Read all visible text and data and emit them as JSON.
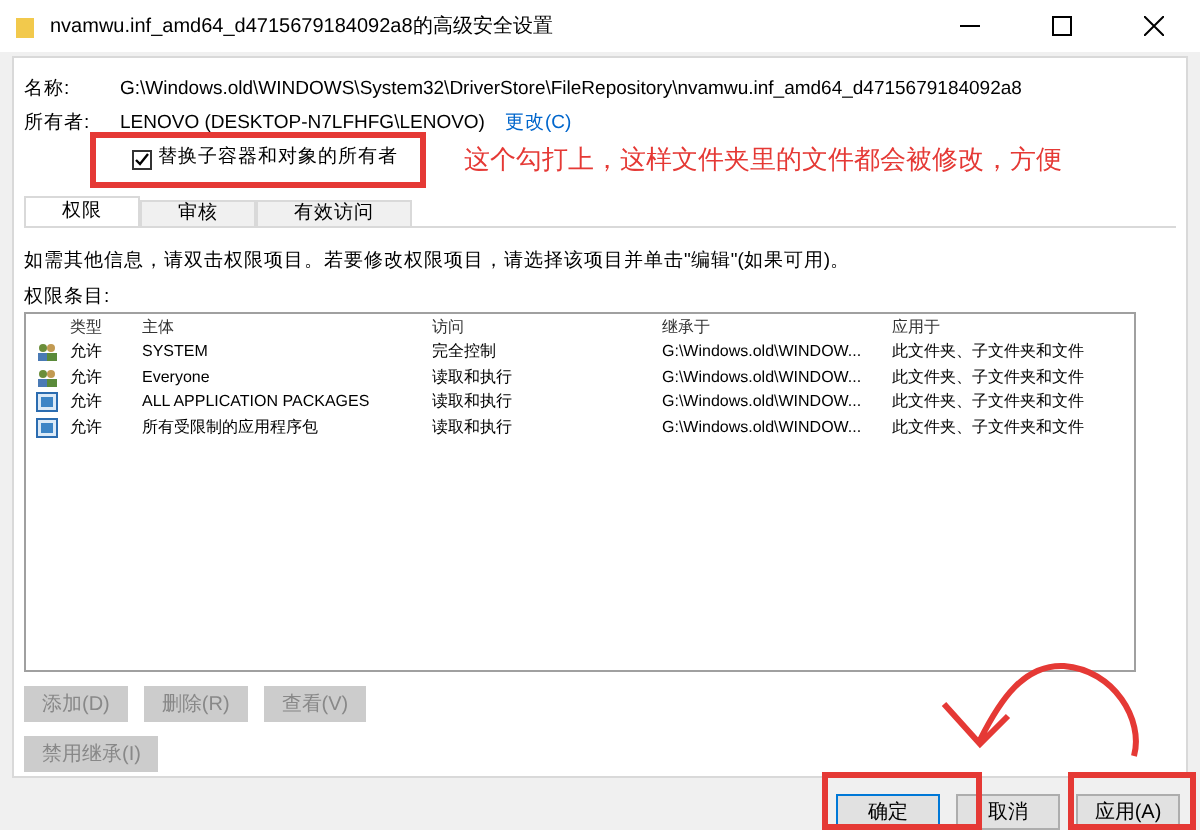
{
  "window": {
    "title": "nvamwu.inf_amd64_d4715679184092a8的高级安全设置"
  },
  "name_label": "名称:",
  "name_value": "G:\\Windows.old\\WINDOWS\\System32\\DriverStore\\FileRepository\\nvamwu.inf_amd64_d4715679184092a8",
  "owner_label": "所有者:",
  "owner_value": "LENOVO (DESKTOP-N7LFHFG\\LENOVO)",
  "owner_change": "更改(C)",
  "replace_owner": {
    "label": "替换子容器和对象的所有者",
    "checked": true
  },
  "annotation": "这个勾打上，这样文件夹里的文件都会被修改，方便",
  "tabs": [
    {
      "label": "权限",
      "selected": true
    },
    {
      "label": "审核",
      "selected": false
    },
    {
      "label": "有效访问",
      "selected": false
    }
  ],
  "info": "如需其他信息，请双击权限项目。若要修改权限项目，请选择该项目并单击\"编辑\"(如果可用)。",
  "entries_label": "权限条目:",
  "table": {
    "columns": [
      "类型",
      "主体",
      "访问",
      "继承于",
      "应用于"
    ],
    "rows": [
      {
        "kind": "user",
        "cells": [
          "允许",
          "SYSTEM",
          "完全控制",
          "G:\\Windows.old\\WINDOW...",
          "此文件夹、子文件夹和文件"
        ]
      },
      {
        "kind": "user",
        "cells": [
          "允许",
          "Everyone",
          "读取和执行",
          "G:\\Windows.old\\WINDOW...",
          "此文件夹、子文件夹和文件"
        ]
      },
      {
        "kind": "package",
        "cells": [
          "允许",
          "ALL APPLICATION PACKAGES",
          "读取和执行",
          "G:\\Windows.old\\WINDOW...",
          "此文件夹、子文件夹和文件"
        ]
      },
      {
        "kind": "package",
        "cells": [
          "允许",
          "所有受限制的应用程序包",
          "读取和执行",
          "G:\\Windows.old\\WINDOW...",
          "此文件夹、子文件夹和文件"
        ]
      }
    ]
  },
  "actions": [
    {
      "label": "添加(D)",
      "disabled": true
    },
    {
      "label": "删除(R)",
      "disabled": true
    },
    {
      "label": "查看(V)",
      "disabled": true
    }
  ],
  "disable_inheritance": {
    "label": "禁用继承(I)",
    "disabled": true
  },
  "footer_buttons": [
    "确定",
    "取消",
    "应用(A)"
  ]
}
